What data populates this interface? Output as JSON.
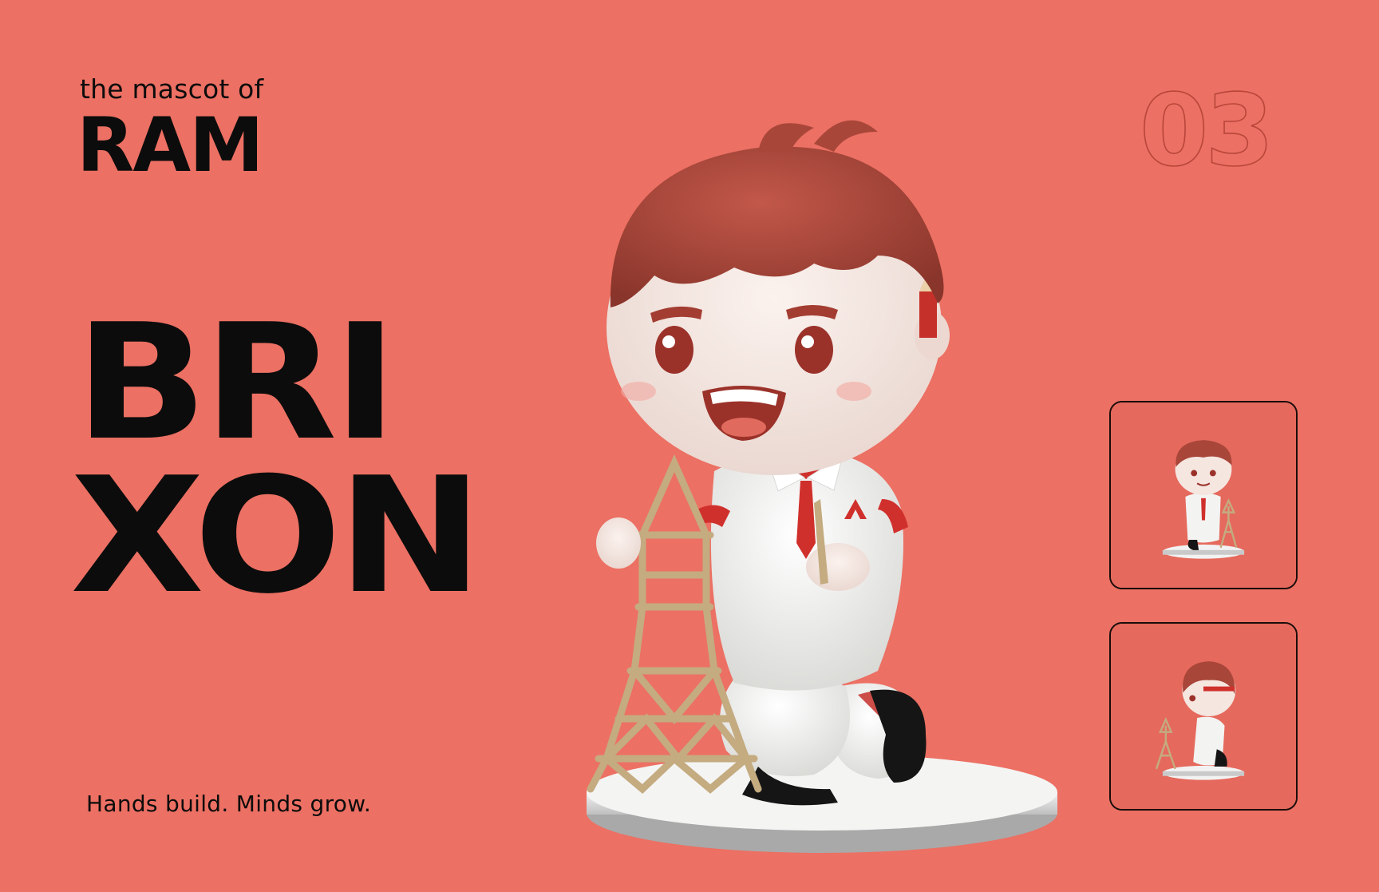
{
  "header": {
    "kicker": "the mascot of",
    "brand": "RAM"
  },
  "mascot": {
    "name_line_1": "BRI",
    "name_line_2": "XON",
    "tagline": "Hands build. Minds grow."
  },
  "page_number": "03",
  "thumbnails": [
    {
      "icon": "mascot-front-view-thumbnail"
    },
    {
      "icon": "mascot-side-view-thumbnail"
    }
  ],
  "colors": {
    "background": "#ec7063",
    "thumbnail_background": "#e5695c",
    "text": "#0c0c0c",
    "page_number_outline": "#b8463b",
    "hair": "#a9463a",
    "uniform": "#efefed",
    "tie": "#d0302c",
    "tower": "#c4ab80"
  }
}
